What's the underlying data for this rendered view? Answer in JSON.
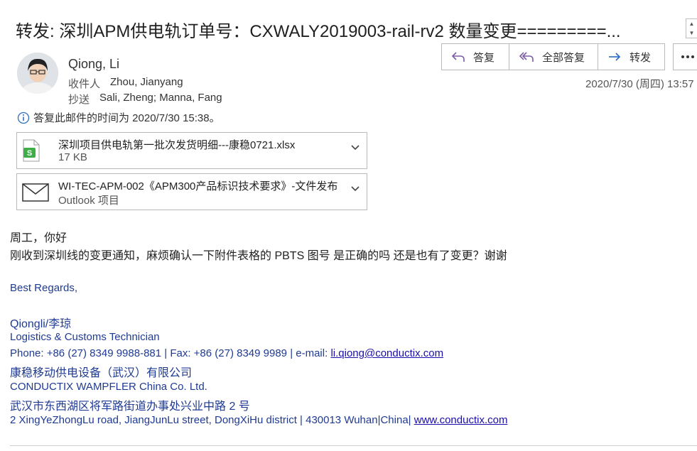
{
  "email": {
    "subject": "转发: 深圳APM供电轨订单号：CXWALY2019003-rail-rv2 数量变更=========...",
    "sender": "Qiong, Li",
    "to_label": "收件人",
    "to_value": "Zhou, Jianyang",
    "cc_label": "抄送",
    "cc_value": "Sali, Zheng; Manna, Fang",
    "date": "2020/7/30 (周四) 13:57",
    "info_text": "答复此邮件的时间为 2020/7/30 15:38。"
  },
  "actions": {
    "reply": "答复",
    "reply_all": "全部答复",
    "forward": "转发"
  },
  "attachments": [
    {
      "name": "深圳项目供电轨第一批次发货明细---康稳0721.xlsx",
      "sub": "17 KB",
      "icon": "excel-icon"
    },
    {
      "name": "WI-TEC-APM-002《APM300产品标识技术要求》-文件发布",
      "sub": "Outlook 项目",
      "icon": "envelope-icon"
    }
  ],
  "body": {
    "greeting": "周工，你好",
    "line1": "刚收到深圳线的变更通知，麻烦确认一下附件表格的 PBTS 图号 是正确的吗 还是也有了变更？谢谢"
  },
  "signature": {
    "regards": "Best Regards,",
    "name": "Qiongli/李琼",
    "title": "Logistics & Customs Technician",
    "phone_fax": "Phone: +86 (27) 8349 9988-881 | Fax: +86 (27) 8349 9989 | e-mail: ",
    "email": "li.qiong@conductix.com",
    "company_cn": "康稳移动供电设备（武汉）有限公司",
    "company_en": "CONDUCTIX WAMPFLER China Co. Ltd.",
    "address_cn": "武汉市东西湖区将军路街道办事处兴业中路 2 号",
    "address_en": "2 XingYeZhongLu road, JiangJunLu street, DongXiHu district | 430013 Wuhan|China| ",
    "website": "www.conductix.com"
  },
  "colors": {
    "accent_purple": "#7b5ea7",
    "forward_blue": "#2b6cc4",
    "signature_blue": "#1f3a93",
    "link": "#1a0dab"
  }
}
